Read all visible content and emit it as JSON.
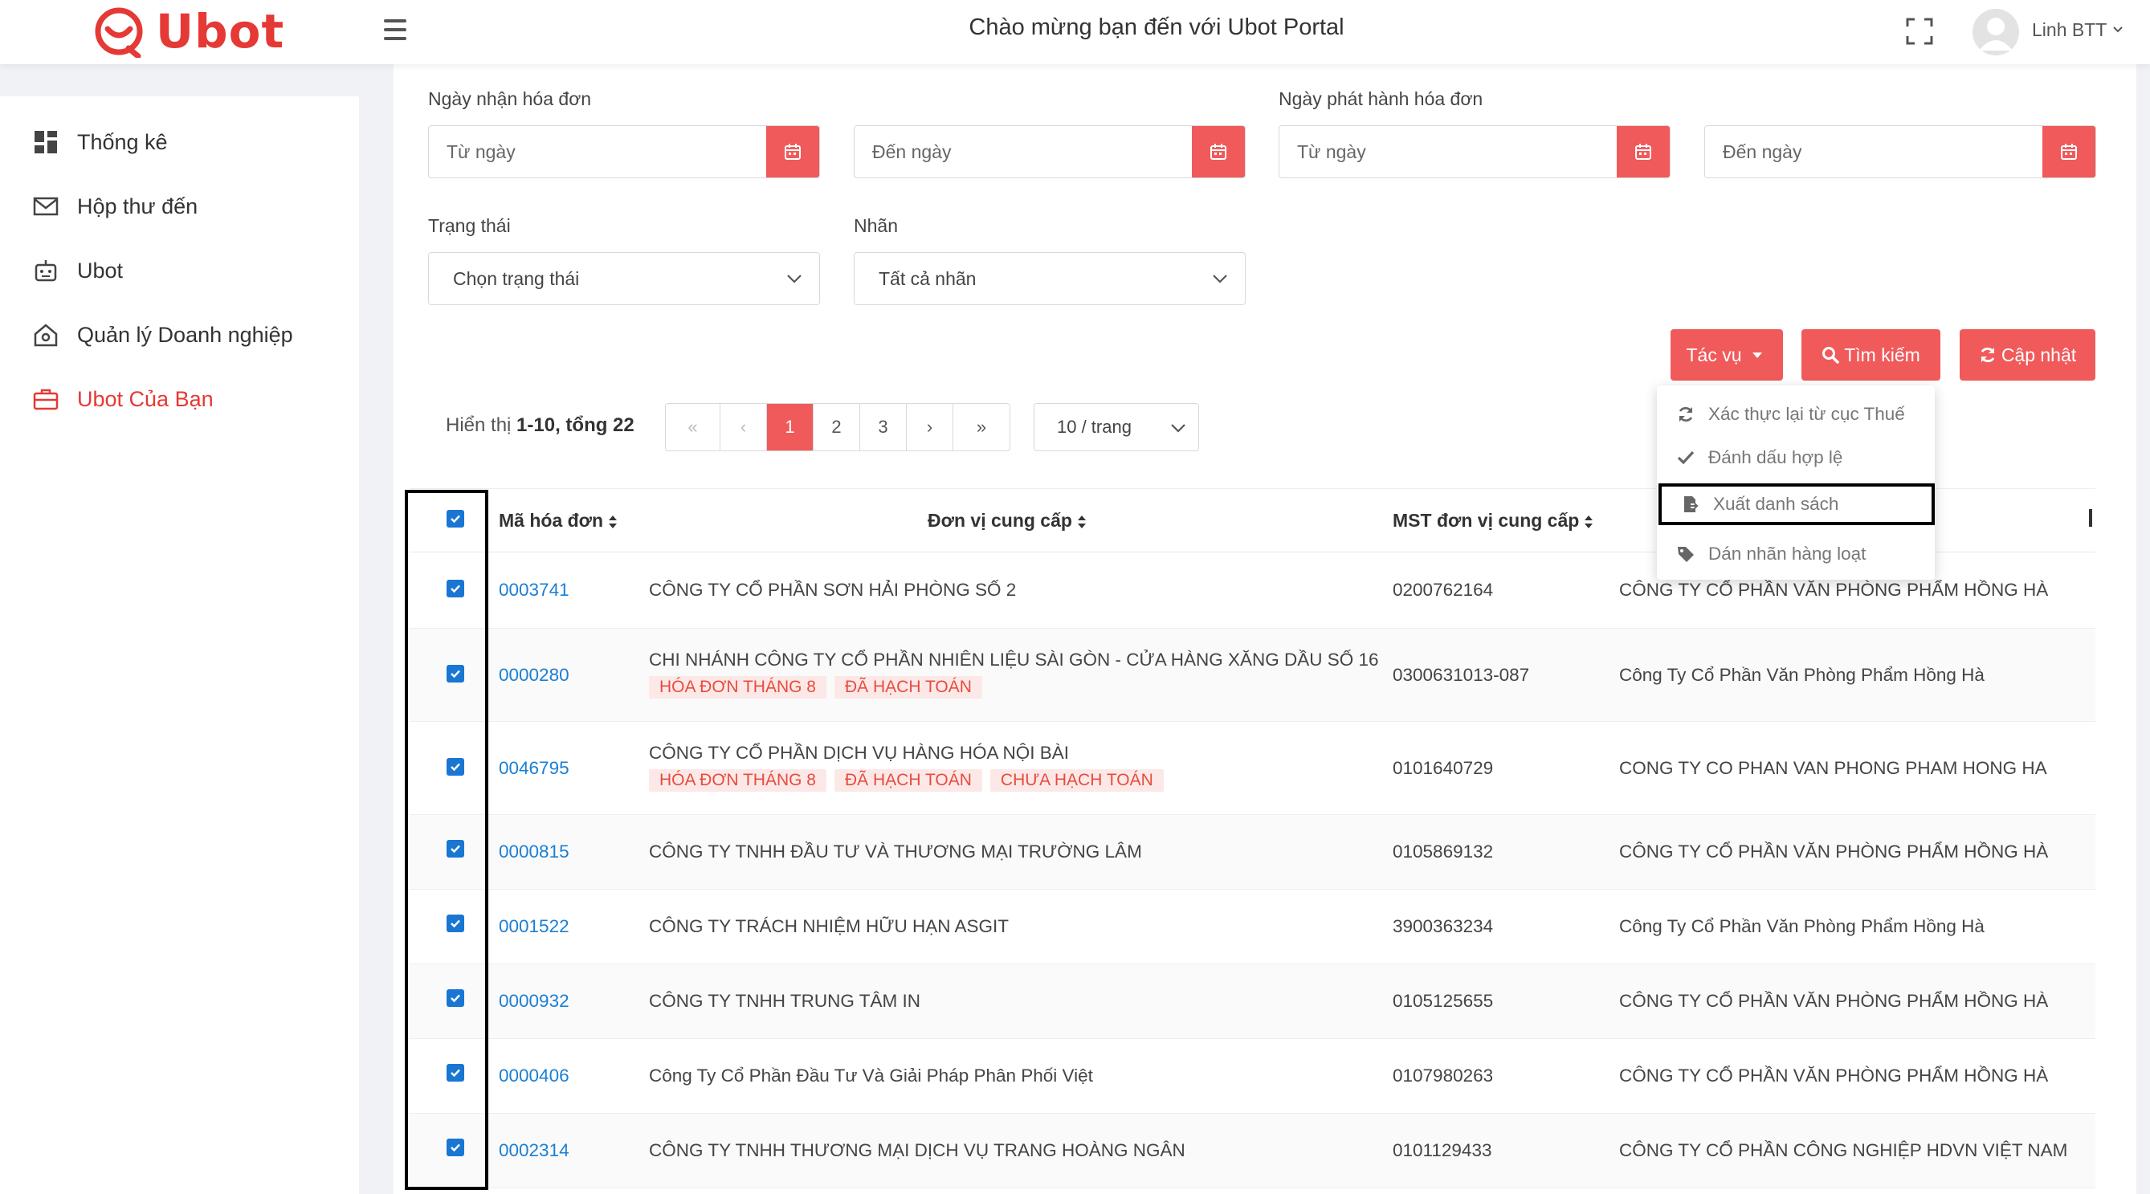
{
  "header": {
    "logo_text": "Ubot",
    "portal_title": "Chào mừng bạn đến với Ubot Portal",
    "user_name": "Linh BTT"
  },
  "sidebar": {
    "items": [
      {
        "label": "Thống kê",
        "icon": "dashboard-icon"
      },
      {
        "label": "Hộp thư đến",
        "icon": "mail-icon"
      },
      {
        "label": "Ubot",
        "icon": "robot-icon"
      },
      {
        "label": "Quản lý Doanh nghiệp",
        "icon": "home-icon"
      },
      {
        "label": "Ubot Của Bạn",
        "icon": "briefcase-icon",
        "active": true
      }
    ]
  },
  "filters": {
    "received_label": "Ngày nhận hóa đơn",
    "issued_label": "Ngày phát hành hóa đơn",
    "from_placeholder": "Từ ngày",
    "to_placeholder": "Đến ngày",
    "status_label": "Trạng thái",
    "status_value": "Chọn trạng thái",
    "tag_label": "Nhãn",
    "tag_value": "Tất cả nhãn"
  },
  "actions": {
    "tasks_label": "Tác vụ",
    "search_label": "Tìm kiếm",
    "update_label": "Cập nhật"
  },
  "dropdown": {
    "items": [
      {
        "label": "Xác thực lại từ cục Thuế",
        "icon": "refresh-icon"
      },
      {
        "label": "Đánh dấu hợp lệ",
        "icon": "check-icon"
      },
      {
        "label": "Xuất danh sách",
        "icon": "export-file-icon",
        "highlighted": true
      },
      {
        "label": "Dán nhãn hàng loạt",
        "icon": "tag-icon"
      }
    ]
  },
  "pagination": {
    "info_prefix": "Hiển thị",
    "info_range": "1-10, tổng 22",
    "first": "«",
    "prev": "‹",
    "pages": [
      "1",
      "2",
      "3"
    ],
    "current": "1",
    "next": "›",
    "last": "»",
    "per_page": "10 / trang"
  },
  "table": {
    "columns": [
      "Mã hóa đơn",
      "Đơn vị cung cấp",
      "MST đơn vị cung cấp"
    ],
    "rows": [
      {
        "code": "0003741",
        "supplier": "CÔNG TY CỔ PHẦN SƠN HẢI PHÒNG SỐ 2",
        "tags": [],
        "tax": "0200762164",
        "buyer": "CÔNG TY CỔ PHẦN VĂN PHÒNG PHẨM HỒNG HÀ"
      },
      {
        "code": "0000280",
        "supplier": "CHI NHÁNH CÔNG TY CỔ PHẦN NHIÊN LIỆU SÀI GÒN - CỬA HÀNG XĂNG DẦU SỐ 16",
        "tags": [
          "HÓA ĐƠN THÁNG 8",
          "ĐÃ HẠCH TOÁN"
        ],
        "tax": "0300631013-087",
        "buyer": "Công Ty Cổ Phần Văn Phòng Phẩm Hồng Hà"
      },
      {
        "code": "0046795",
        "supplier": "CÔNG TY CỔ PHẦN DỊCH VỤ HÀNG HÓA NỘI BÀI",
        "tags": [
          "HÓA ĐƠN THÁNG 8",
          "ĐÃ HẠCH TOÁN",
          "CHƯA HẠCH TOÁN"
        ],
        "tax": "0101640729",
        "buyer": "CONG TY CO PHAN VAN PHONG PHAM HONG HA"
      },
      {
        "code": "0000815",
        "supplier": "CÔNG TY TNHH ĐẦU TƯ VÀ THƯƠNG MẠI TRƯỜNG LÂM",
        "tags": [],
        "tax": "0105869132",
        "buyer": "CÔNG TY CỔ PHẦN VĂN PHÒNG PHẨM HỒNG HÀ"
      },
      {
        "code": "0001522",
        "supplier": "CÔNG TY TRÁCH NHIỆM HỮU HẠN ASGIT",
        "tags": [],
        "tax": "3900363234",
        "buyer": "Công Ty Cổ Phần Văn Phòng Phẩm Hồng Hà"
      },
      {
        "code": "0000932",
        "supplier": "CÔNG TY TNHH TRUNG TÂM IN",
        "tags": [],
        "tax": "0105125655",
        "buyer": "CÔNG TY CỔ PHẦN VĂN PHÒNG PHẨM HỒNG HÀ"
      },
      {
        "code": "0000406",
        "supplier": "Công Ty Cổ Phần Đầu Tư Và Giải Pháp Phân Phối Việt",
        "tags": [],
        "tax": "0107980263",
        "buyer": "CÔNG TY CỔ PHẦN VĂN PHÒNG PHẨM HỒNG HÀ"
      },
      {
        "code": "0002314",
        "supplier": "CÔNG TY TNHH THƯƠNG MẠI DỊCH VỤ TRANG HOÀNG NGÂN",
        "tags": [],
        "tax": "0101129433",
        "buyer": "CÔNG TY CỔ PHẦN CÔNG NGHIỆP HDVN VIỆT NAM"
      }
    ]
  },
  "colors": {
    "brand_red": "#e53935",
    "button_red": "#f05a5a",
    "link_blue": "#1a7fd4",
    "checkbox_blue": "#1976d2",
    "tag_bg": "#fde8e8"
  }
}
